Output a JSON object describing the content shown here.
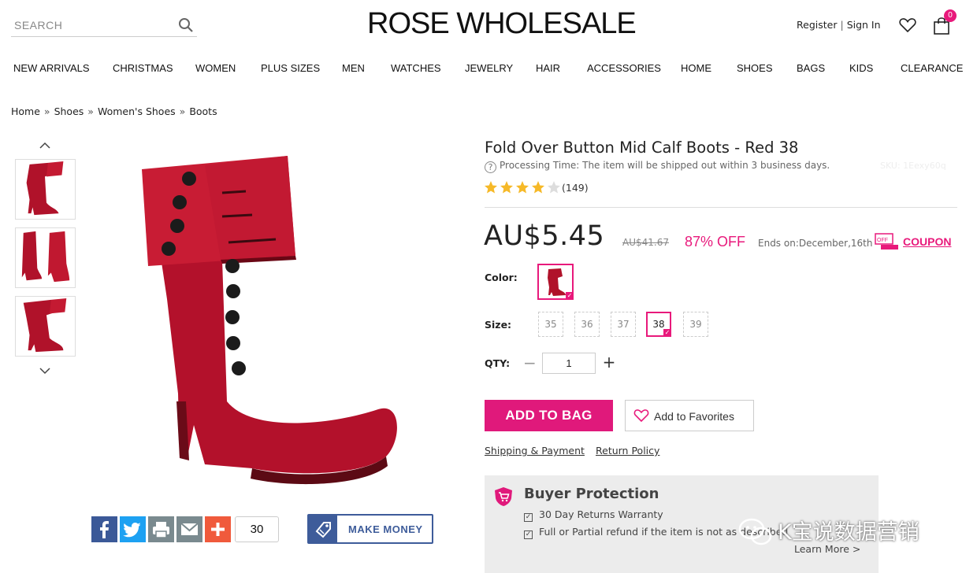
{
  "search": {
    "placeholder": "SEARCH"
  },
  "header": {
    "logo": "ROSE WHOLESALE",
    "register": "Register",
    "separator": "|",
    "sign_in": "Sign In",
    "bag_count": "0"
  },
  "nav": {
    "items": [
      "NEW ARRIVALS",
      "CHRISTMAS",
      "WOMEN",
      "PLUS SIZES",
      "MEN",
      "WATCHES",
      "JEWELRY",
      "HAIR",
      "ACCESSORIES",
      "HOME",
      "SHOES",
      "BAGS",
      "KIDS",
      "CLEARANCE"
    ]
  },
  "breadcrumb": {
    "items": [
      "Home",
      "Shoes",
      "Women's Shoes",
      "Boots"
    ],
    "separator": "»"
  },
  "product": {
    "title": "Fold Over Button Mid Calf Boots - Red 38",
    "processing_icon": "?",
    "processing": "Processing Time: The item will be shipped out within 3 business days.",
    "sku": "SKU: 1Eexy60q",
    "rating": 4,
    "rating_max": 5,
    "review_count": "(149)",
    "price": "AU$5.45",
    "old_price": "AU$41.67",
    "discount": "87% OFF",
    "ends": "Ends on:December,16th",
    "coupon": "COUPON",
    "color_label": "Color:",
    "size_label": "Size:",
    "sizes": [
      "35",
      "36",
      "37",
      "38",
      "39"
    ],
    "selected_size": "38",
    "qty_label": "QTY:",
    "qty_minus": "−",
    "qty_value": "1",
    "qty_plus": "+",
    "add_to_bag": "ADD TO BAG",
    "add_to_favorites": "Add to Favorites",
    "shipping_link": "Shipping & Payment",
    "return_link": "Return Policy",
    "accent_color": "#e8197b"
  },
  "share": {
    "count": "30",
    "make_money": "MAKE MONEY"
  },
  "protection": {
    "title": "Buyer Protection",
    "items": [
      "30 Day Returns Warranty",
      "Full or Partial refund if the item is not as described"
    ],
    "learn_more": "Learn More >"
  },
  "watermark": {
    "text": "K宝说数据营销"
  }
}
